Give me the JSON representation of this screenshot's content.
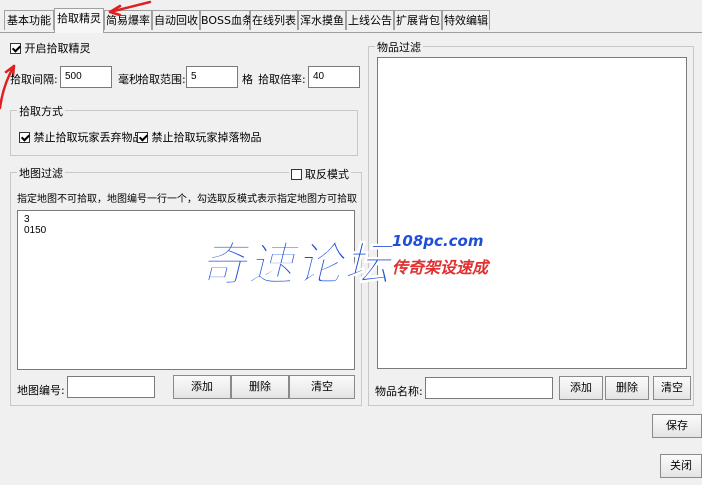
{
  "tabs": [
    "基本功能",
    "拾取精灵",
    "简易爆率",
    "自动回收",
    "BOSS血条",
    "在线列表",
    "浑水摸鱼",
    "上线公告",
    "扩展背包",
    "特效编辑"
  ],
  "enable_pickup": {
    "label": "开启拾取精灵",
    "checked": true
  },
  "pickup_interval": {
    "label": "拾取间隔:",
    "value": "500",
    "unit": "毫秒"
  },
  "pickup_range": {
    "label": "拾取范围:",
    "value": "5",
    "unit": "格"
  },
  "pickup_multiplier": {
    "label": "拾取倍率:",
    "value": "40"
  },
  "pickup_mode": {
    "title": "拾取方式",
    "options": [
      {
        "label": "禁止拾取玩家丢弃物品",
        "checked": true
      },
      {
        "label": "禁止拾取玩家掉落物品",
        "checked": true
      }
    ]
  },
  "map_filter": {
    "title": "地图过滤",
    "invert_label": "取反模式",
    "invert_checked": false,
    "hint": "指定地图不可拾取，地图编号一行一个，勾选取反模式表示指定地图方可拾取",
    "entries": [
      "3",
      "0150"
    ],
    "map_id_label": "地图编号:",
    "add": "添加",
    "delete": "删除",
    "clear": "清空"
  },
  "item_filter": {
    "title": "物品过滤",
    "item_name_label": "物品名称:",
    "add": "添加",
    "delete": "删除",
    "clear": "清空"
  },
  "save": "保存",
  "close": "关闭",
  "watermark": {
    "main": "奇速论坛",
    "url": "108pc.com",
    "sub": "传奇架设速成"
  },
  "colors": {
    "annotation_arrow": "#e02020",
    "watermark_blue": "#1f4fd8",
    "watermark_red": "#e03030"
  }
}
